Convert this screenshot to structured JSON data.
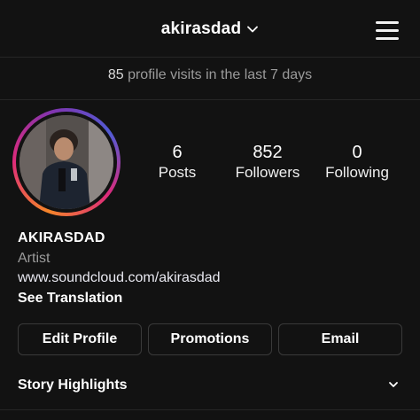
{
  "header": {
    "username": "akirasdad",
    "username_chevron_icon": "chevron-down-icon",
    "menu_icon": "hamburger-menu-icon"
  },
  "visits": {
    "count": "85",
    "text": "profile visits in the last 7 days"
  },
  "profile": {
    "avatar_ring_colors": [
      "#f58529",
      "#dd2a7b",
      "#8134af",
      "#515bd4"
    ],
    "stats": [
      {
        "value": "6",
        "label": "Posts"
      },
      {
        "value": "852",
        "label": "Followers"
      },
      {
        "value": "0",
        "label": "Following"
      }
    ]
  },
  "bio": {
    "name": "AKIRASDAD",
    "category": "Artist",
    "link": "www.soundcloud.com/akirasdad",
    "translation": "See Translation"
  },
  "actions": {
    "edit_profile": "Edit Profile",
    "promotions": "Promotions",
    "email": "Email"
  },
  "highlights": {
    "label": "Story Highlights",
    "toggle_icon": "chevron-down-icon"
  },
  "colors": {
    "background": "#121212",
    "text": "#ffffff",
    "muted": "#9b9b9b",
    "border": "#3a3a3a"
  }
}
